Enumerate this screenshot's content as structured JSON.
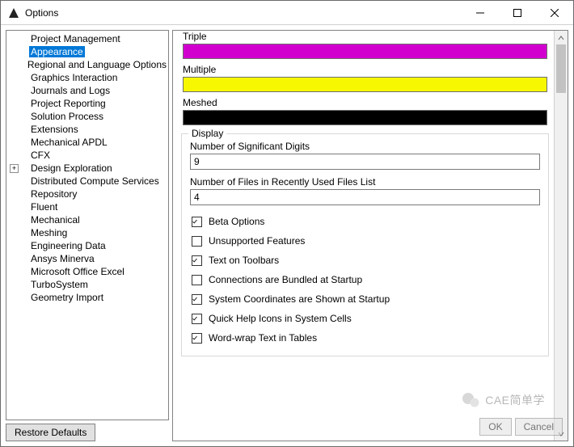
{
  "window": {
    "title": "Options",
    "min_tip": "Minimize",
    "max_tip": "Maximize",
    "close_tip": "Close"
  },
  "tree": {
    "items": [
      {
        "label": "Project Management",
        "expandable": false,
        "selected": false
      },
      {
        "label": "Appearance",
        "expandable": false,
        "selected": true
      },
      {
        "label": "Regional and Language Options",
        "expandable": false,
        "selected": false
      },
      {
        "label": "Graphics Interaction",
        "expandable": false,
        "selected": false
      },
      {
        "label": "Journals and Logs",
        "expandable": false,
        "selected": false
      },
      {
        "label": "Project Reporting",
        "expandable": false,
        "selected": false
      },
      {
        "label": "Solution Process",
        "expandable": false,
        "selected": false
      },
      {
        "label": "Extensions",
        "expandable": false,
        "selected": false
      },
      {
        "label": "Mechanical APDL",
        "expandable": false,
        "selected": false
      },
      {
        "label": "CFX",
        "expandable": false,
        "selected": false
      },
      {
        "label": "Design Exploration",
        "expandable": true,
        "selected": false
      },
      {
        "label": "Distributed Compute Services",
        "expandable": false,
        "selected": false
      },
      {
        "label": "Repository",
        "expandable": false,
        "selected": false
      },
      {
        "label": "Fluent",
        "expandable": false,
        "selected": false
      },
      {
        "label": "Mechanical",
        "expandable": false,
        "selected": false
      },
      {
        "label": "Meshing",
        "expandable": false,
        "selected": false
      },
      {
        "label": "Engineering Data",
        "expandable": false,
        "selected": false
      },
      {
        "label": "Ansys Minerva",
        "expandable": false,
        "selected": false
      },
      {
        "label": "Microsoft Office Excel",
        "expandable": false,
        "selected": false
      },
      {
        "label": "TurboSystem",
        "expandable": false,
        "selected": false
      },
      {
        "label": "Geometry Import",
        "expandable": false,
        "selected": false
      }
    ],
    "restore_label": "Restore Defaults"
  },
  "colors": [
    {
      "label": "Triple",
      "value": "#d100cf"
    },
    {
      "label": "Multiple",
      "value": "#f6f700"
    },
    {
      "label": "Meshed",
      "value": "#000000"
    }
  ],
  "display": {
    "legend": "Display",
    "sig_digits_label": "Number of Significant Digits",
    "sig_digits_value": "9",
    "recent_files_label": "Number of Files in Recently Used Files List",
    "recent_files_value": "4",
    "checks": [
      {
        "label": "Beta Options",
        "checked": true
      },
      {
        "label": "Unsupported Features",
        "checked": false
      },
      {
        "label": "Text on Toolbars",
        "checked": true
      },
      {
        "label": "Connections are Bundled at Startup",
        "checked": false
      },
      {
        "label": "System Coordinates are Shown at Startup",
        "checked": true
      },
      {
        "label": "Quick Help Icons in System Cells",
        "checked": true
      },
      {
        "label": "Word-wrap Text in Tables",
        "checked": true
      }
    ]
  },
  "buttons": {
    "ok": "OK",
    "cancel": "Cancel"
  },
  "watermark": "CAE简单学"
}
